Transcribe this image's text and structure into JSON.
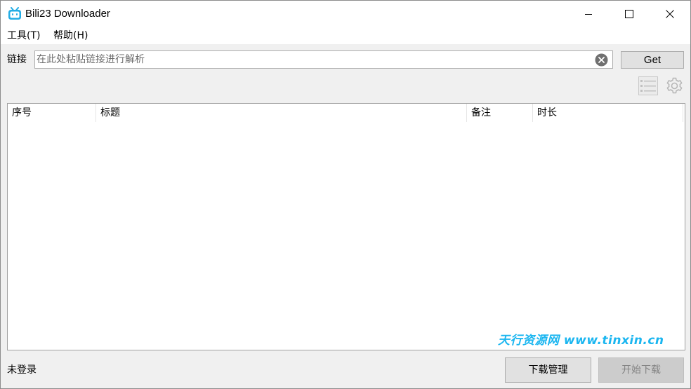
{
  "window": {
    "title": "Bili23 Downloader",
    "accent_color": "#23ade5"
  },
  "menu": {
    "tools": "工具(T)",
    "help": "帮助(H)"
  },
  "url_bar": {
    "label": "链接",
    "placeholder": "在此处粘贴链接进行解析",
    "value": "",
    "get_label": "Get"
  },
  "toolbar": {
    "list_icon": "list-icon",
    "settings_icon": "gear-icon"
  },
  "table": {
    "columns": [
      "序号",
      "标题",
      "备注",
      "时长"
    ],
    "rows": []
  },
  "watermark": "天行资源网 www.tinxin.cn",
  "footer": {
    "status": "未登录",
    "download_manager_label": "下载管理",
    "start_download_label": "开始下载",
    "start_download_enabled": false
  }
}
